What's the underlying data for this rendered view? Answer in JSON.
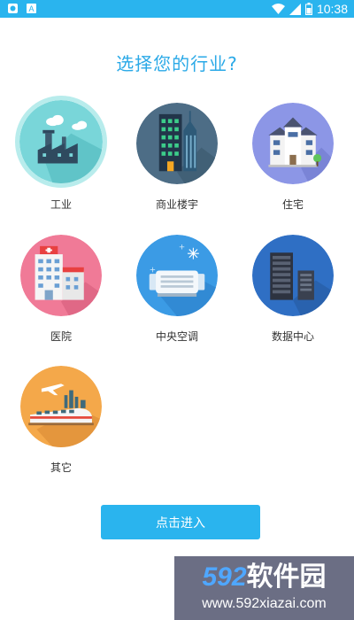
{
  "status_bar": {
    "time": "10:38",
    "left_icons": [
      "app-notification-icon",
      "a-letter-notification-icon"
    ],
    "right_icons": [
      "wifi-icon",
      "signal-icon",
      "battery-icon"
    ]
  },
  "page": {
    "title": "选择您的行业?"
  },
  "industries": [
    {
      "label": "工业",
      "icon": "factory-icon",
      "selected": true
    },
    {
      "label": "商业楼宇",
      "icon": "office-building-icon",
      "selected": false
    },
    {
      "label": "住宅",
      "icon": "residence-icon",
      "selected": false
    },
    {
      "label": "医院",
      "icon": "hospital-icon",
      "selected": false
    },
    {
      "label": "中央空调",
      "icon": "air-conditioner-icon",
      "selected": false
    },
    {
      "label": "数据中心",
      "icon": "server-icon",
      "selected": false
    },
    {
      "label": "其它",
      "icon": "train-plane-icon",
      "selected": false
    }
  ],
  "enter_button": {
    "label": "点击进入"
  },
  "watermark": {
    "brand_prefix": "592",
    "brand_suffix": "软件园",
    "url": "www.592xiazai.com"
  },
  "colors": {
    "accent": "#2ab4ee",
    "title": "#2aa9e7"
  }
}
